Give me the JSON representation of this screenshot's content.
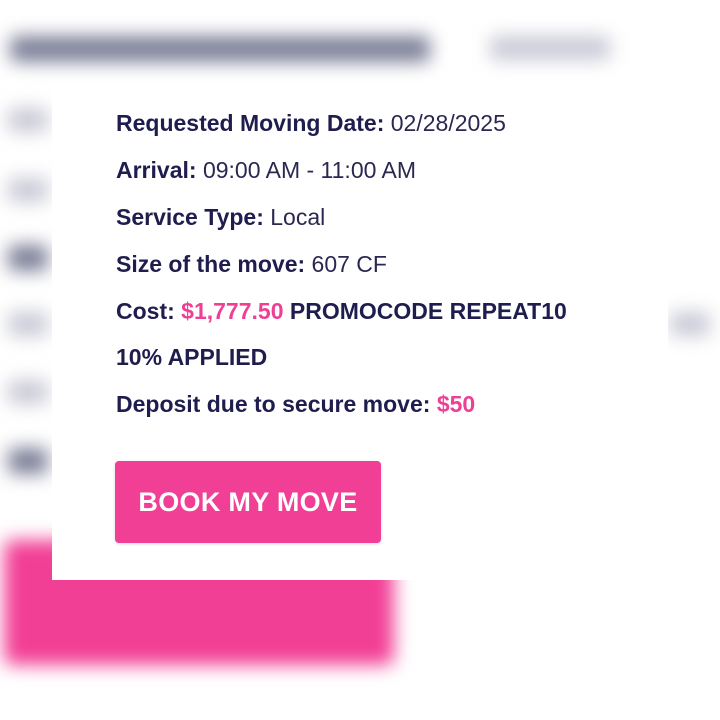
{
  "details": {
    "requested_date_label": "Requested Moving Date:",
    "requested_date_value": "02/28/2025",
    "arrival_label": "Arrival:",
    "arrival_value": "09:00 AM - 11:00 AM",
    "service_type_label": "Service Type:",
    "service_type_value": "Local",
    "size_label": "Size of the move:",
    "size_value": "607 CF",
    "cost_label": "Cost:",
    "cost_value": "$1,777.50",
    "promo_text": "PROMOCODE REPEAT10",
    "promo_applied": "10% APPLIED",
    "deposit_label": "Deposit due to secure move:",
    "deposit_value": "$50"
  },
  "actions": {
    "book_label": "BOOK MY MOVE"
  },
  "colors": {
    "accent": "#f23f96",
    "text": "#1f1d4d"
  }
}
